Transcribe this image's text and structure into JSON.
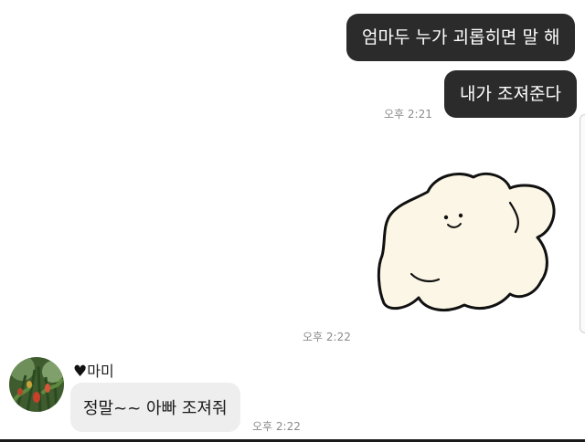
{
  "messages": {
    "sent_1": "엄마두 누가 괴롭히면 말 해",
    "sent_2": "내가 조져준다",
    "sent_time": "오후 2:21",
    "sticker_time": "오후 2:22",
    "received_text": "정말~~ 아빠 조져줘",
    "received_time": "오후 2:22"
  },
  "sender": {
    "heart": "♥",
    "name": "마미"
  },
  "colors": {
    "outgoing_bubble": "#2b2b2b",
    "incoming_bubble": "#eeeeee",
    "timestamp": "#8a8a8a",
    "sticker_fill": "#fbf6e6"
  },
  "icons": {
    "sticker": "smiling-blob-sticker",
    "avatar": "tulip-photo-avatar"
  }
}
